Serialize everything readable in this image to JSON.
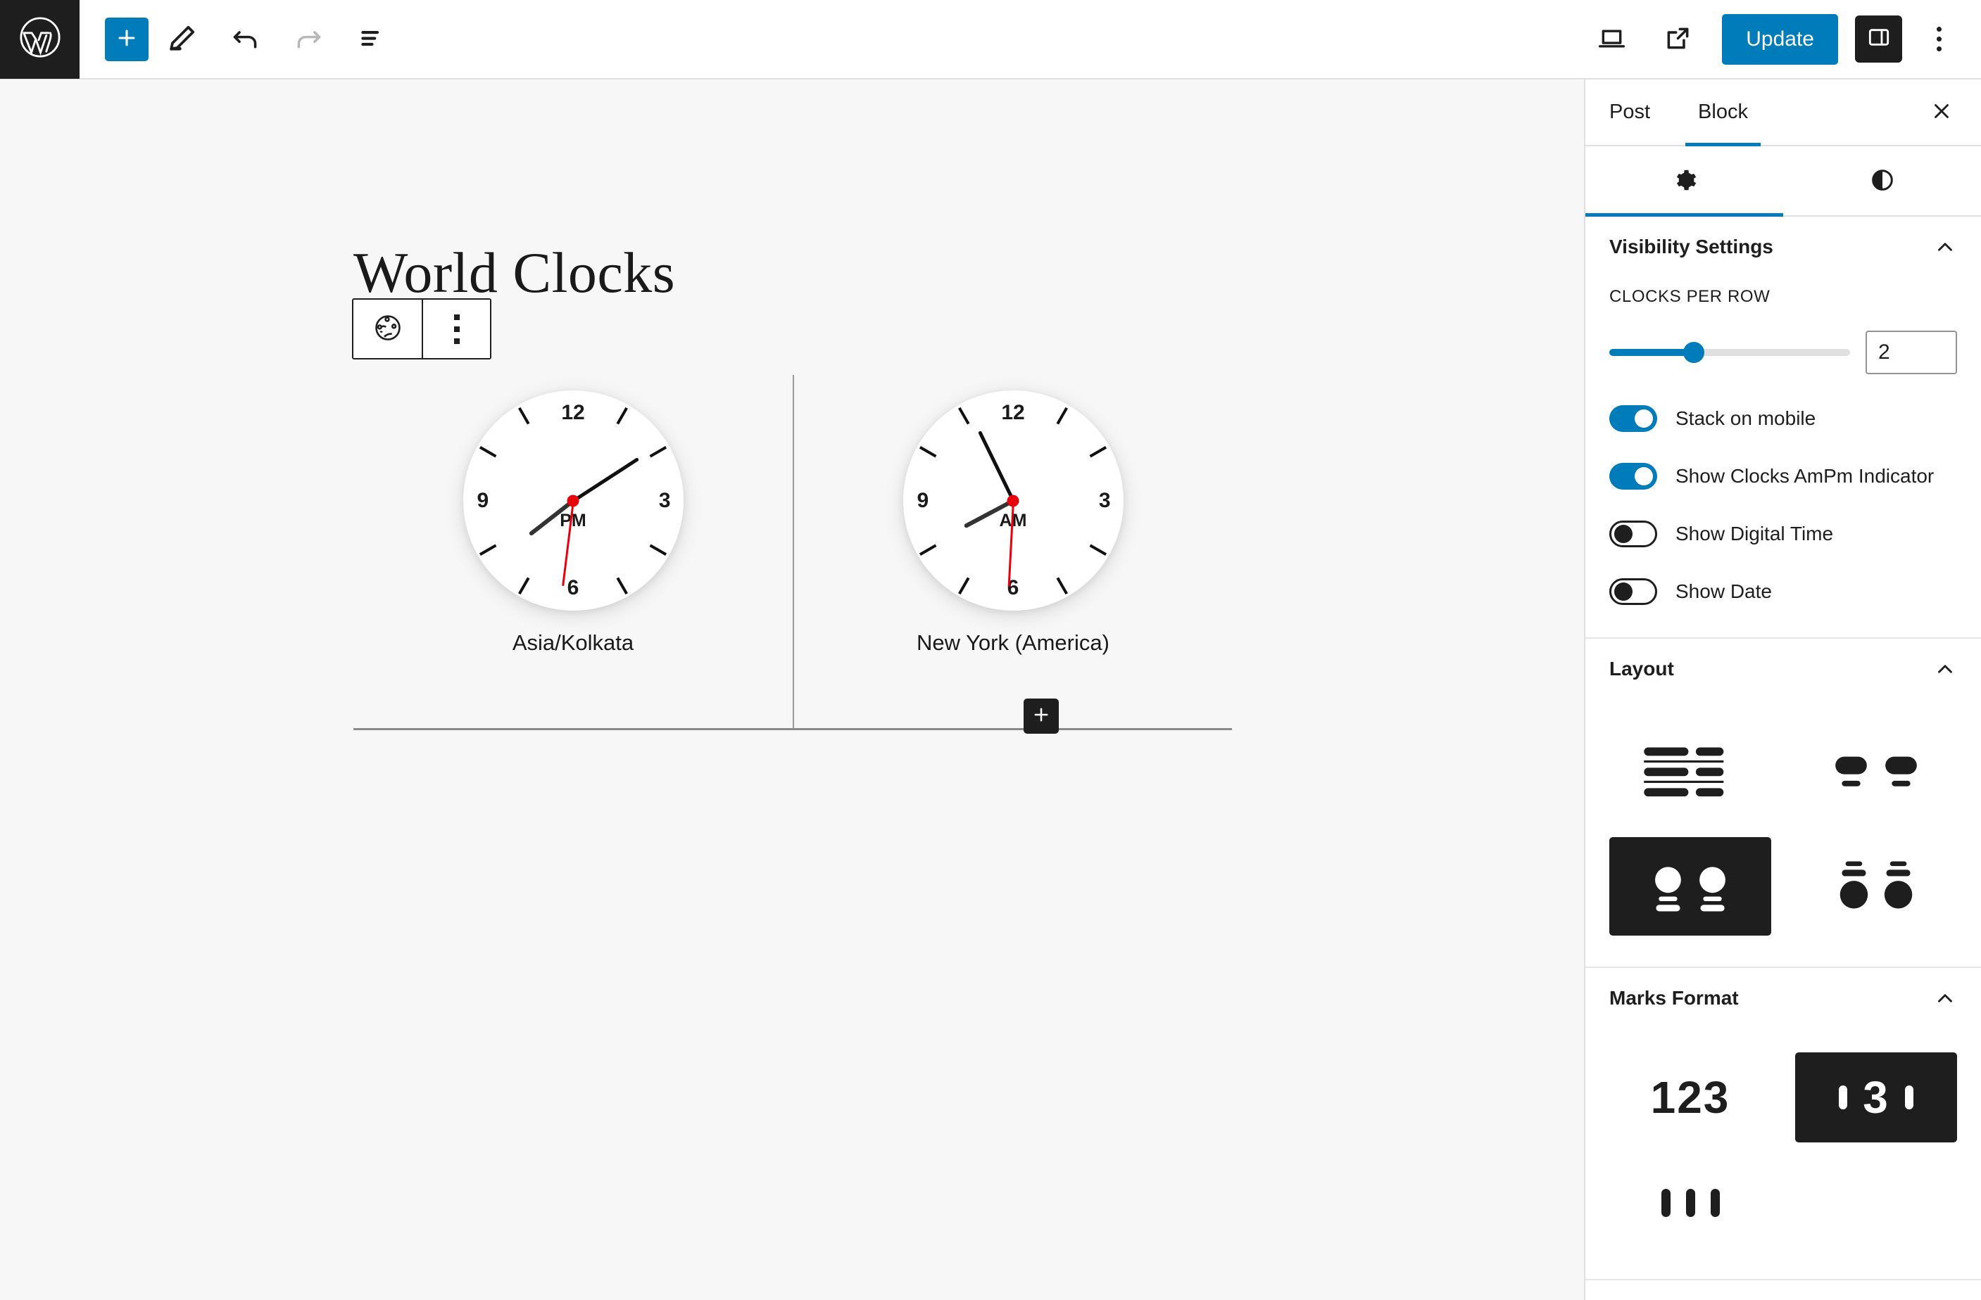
{
  "topbar": {
    "logo_icon": "wordpress-logo-icon",
    "add_block_label": "+",
    "tools": [
      {
        "name": "add-block-button",
        "icon": "plus-icon"
      },
      {
        "name": "edit-tool-button",
        "icon": "pencil-icon"
      },
      {
        "name": "undo-button",
        "icon": "undo-arrow-icon"
      },
      {
        "name": "redo-button",
        "icon": "redo-arrow-icon"
      },
      {
        "name": "document-overview-button",
        "icon": "list-view-icon"
      }
    ],
    "view_icon": "desktop-preview-icon",
    "external_icon": "view-post-external-link-icon",
    "update_label": "Update",
    "settings_icon": "sidebar-panel-icon",
    "options_icon": "three-dots-vertical-icon"
  },
  "editor": {
    "post_title": "World Clocks",
    "block_toolbar": {
      "block_icon": "world-clock-globe-icon",
      "options_icon": "three-dots-vertical-icon"
    },
    "add_block_button_icon": "plus-icon",
    "clocks": [
      {
        "label": "Asia/Kolkata",
        "ampm": "PM",
        "hour_deg": 232,
        "minute_deg": 57,
        "second_deg": 187
      },
      {
        "label": "New York (America)",
        "ampm": "AM",
        "hour_deg": 242,
        "minute_deg": 334,
        "second_deg": 183
      }
    ],
    "clock_numbers": {
      "top": "12",
      "right": "3",
      "bottom": "6",
      "left": "9"
    }
  },
  "sidebar": {
    "tabs": [
      {
        "label": "Post",
        "active": false
      },
      {
        "label": "Block",
        "active": true
      }
    ],
    "close_icon": "close-x-icon",
    "icon_tabs": [
      {
        "name": "settings-tab",
        "icon": "gear-icon",
        "active": true
      },
      {
        "name": "styles-tab",
        "icon": "contrast-half-circle-icon",
        "active": false
      }
    ],
    "panels": [
      {
        "title": "Visibility Settings",
        "collapse_icon": "chevron-up-icon",
        "clocks_per_row_label": "CLOCKS PER ROW",
        "clocks_per_row_value": "2",
        "slider_percent": 35,
        "toggles": [
          {
            "label": "Stack on mobile",
            "on": true
          },
          {
            "label": "Show Clocks AmPm Indicator",
            "on": true
          },
          {
            "label": "Show Digital Time",
            "on": false
          },
          {
            "label": "Show Date",
            "on": false
          }
        ]
      },
      {
        "title": "Layout",
        "collapse_icon": "chevron-up-icon",
        "options": [
          {
            "name": "layout-list-rows",
            "selected": false
          },
          {
            "name": "layout-pill-pair",
            "selected": false
          },
          {
            "name": "layout-circle-pair-label-below",
            "selected": true
          },
          {
            "name": "layout-circle-pair-label-above",
            "selected": false
          }
        ]
      },
      {
        "title": "Marks Format",
        "collapse_icon": "chevron-up-icon",
        "options": [
          {
            "name": "marks-numerals",
            "label": "123",
            "selected": false
          },
          {
            "name": "marks-numeral-with-ticks",
            "label": "3",
            "selected": true
          },
          {
            "name": "marks-ticks-only",
            "label": "",
            "selected": false
          }
        ]
      }
    ]
  },
  "colors": {
    "accent": "#007cba",
    "dark": "#1e1e1e",
    "second_hand": "#e8000d",
    "canvas_bg": "#f7f7f7"
  }
}
